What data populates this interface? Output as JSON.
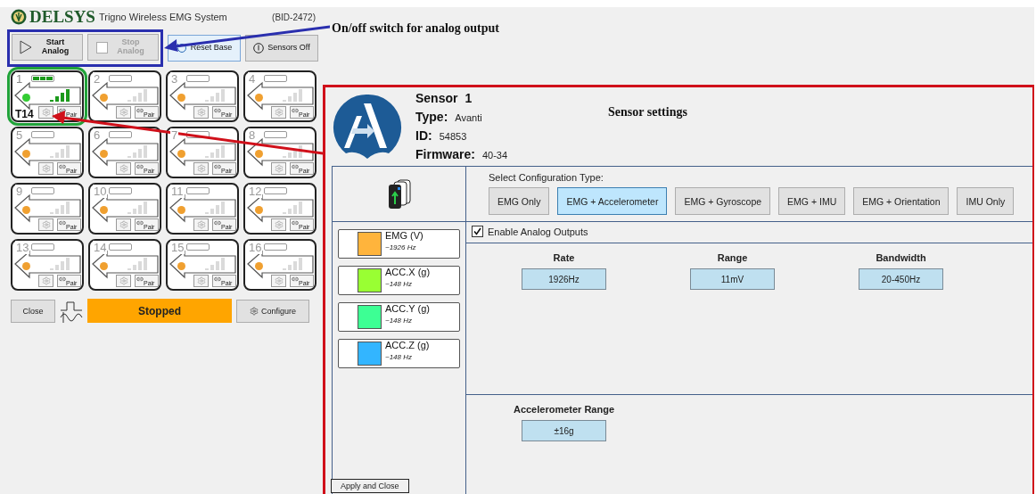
{
  "app": {
    "brand": "DELSYS",
    "title": "Trigno Wireless EMG System",
    "base_id": "(BID-2472)"
  },
  "toolbar": [
    {
      "label": "Start Analog",
      "kind": "play",
      "disabled": false,
      "focused": false
    },
    {
      "label": "Stop Analog",
      "kind": "stop",
      "disabled": true,
      "focused": false
    },
    {
      "label": "Reset Base",
      "kind": "reset",
      "disabled": false,
      "focused": true
    },
    {
      "label": "Sensors Off",
      "kind": "power",
      "disabled": false,
      "focused": false
    }
  ],
  "sensors": [
    {
      "number": "1",
      "connected": true,
      "highlighted": true,
      "tag": "T14",
      "pair_label": "Pair"
    },
    {
      "number": "2",
      "connected": false,
      "highlighted": false,
      "pair_label": "Pair"
    },
    {
      "number": "3",
      "connected": false,
      "highlighted": false,
      "pair_label": "Pair"
    },
    {
      "number": "4",
      "connected": false,
      "highlighted": false,
      "pair_label": "Pair"
    },
    {
      "number": "5",
      "connected": false,
      "highlighted": false,
      "pair_label": "Pair"
    },
    {
      "number": "6",
      "connected": false,
      "highlighted": false,
      "pair_label": "Pair"
    },
    {
      "number": "7",
      "connected": false,
      "highlighted": false,
      "pair_label": "Pair"
    },
    {
      "number": "8",
      "connected": false,
      "highlighted": false,
      "pair_label": "Pair"
    },
    {
      "number": "9",
      "connected": false,
      "highlighted": false,
      "pair_label": "Pair"
    },
    {
      "number": "10",
      "connected": false,
      "highlighted": false,
      "pair_label": "Pair"
    },
    {
      "number": "11",
      "connected": false,
      "highlighted": false,
      "pair_label": "Pair"
    },
    {
      "number": "12",
      "connected": false,
      "highlighted": false,
      "pair_label": "Pair"
    },
    {
      "number": "13",
      "connected": false,
      "highlighted": false,
      "pair_label": "Pair"
    },
    {
      "number": "14",
      "connected": false,
      "highlighted": false,
      "pair_label": "Pair"
    },
    {
      "number": "15",
      "connected": false,
      "highlighted": false,
      "pair_label": "Pair"
    },
    {
      "number": "16",
      "connected": false,
      "highlighted": false,
      "pair_label": "Pair"
    }
  ],
  "footer": {
    "close": "Close",
    "status": "Stopped",
    "configure": "Configure"
  },
  "annotation": {
    "label": "On/off switch for analog output"
  },
  "settings_panel": {
    "title": "Sensor settings",
    "sensor_label": "Sensor",
    "sensor_number": "1",
    "fields": [
      {
        "label": "Type:",
        "value": "Avanti"
      },
      {
        "label": "ID:",
        "value": "54853"
      },
      {
        "label": "Firmware:",
        "value": "40-34"
      }
    ],
    "config_prompt": "Select Configuration Type:",
    "config_types": [
      {
        "label": "EMG Only",
        "selected": false
      },
      {
        "label": "EMG + Accelerometer",
        "selected": true
      },
      {
        "label": "EMG + Gyroscope",
        "selected": false
      },
      {
        "label": "EMG + IMU",
        "selected": false
      },
      {
        "label": "EMG + Orientation",
        "selected": false
      },
      {
        "label": "IMU Only",
        "selected": false
      }
    ],
    "channels": [
      {
        "name": "EMG (V)",
        "rate": "~1926 Hz",
        "color": "#ffb43c"
      },
      {
        "name": "ACC.X (g)",
        "rate": "~148 Hz",
        "color": "#99ff33"
      },
      {
        "name": "ACC.Y (g)",
        "rate": "~148 Hz",
        "color": "#3dff94"
      },
      {
        "name": "ACC.Z (g)",
        "rate": "~148 Hz",
        "color": "#33b5ff"
      }
    ],
    "enable_analog": {
      "label": "Enable Analog Outputs",
      "checked": true
    },
    "settings": [
      {
        "label": "Rate",
        "value": "1926Hz"
      },
      {
        "label": "Range",
        "value": "11mV"
      },
      {
        "label": "Bandwidth",
        "value": "20-450Hz"
      }
    ],
    "accelerometer_range": {
      "label": "Accelerometer Range",
      "value": "±16g"
    },
    "apply_button": "Apply and Close"
  }
}
